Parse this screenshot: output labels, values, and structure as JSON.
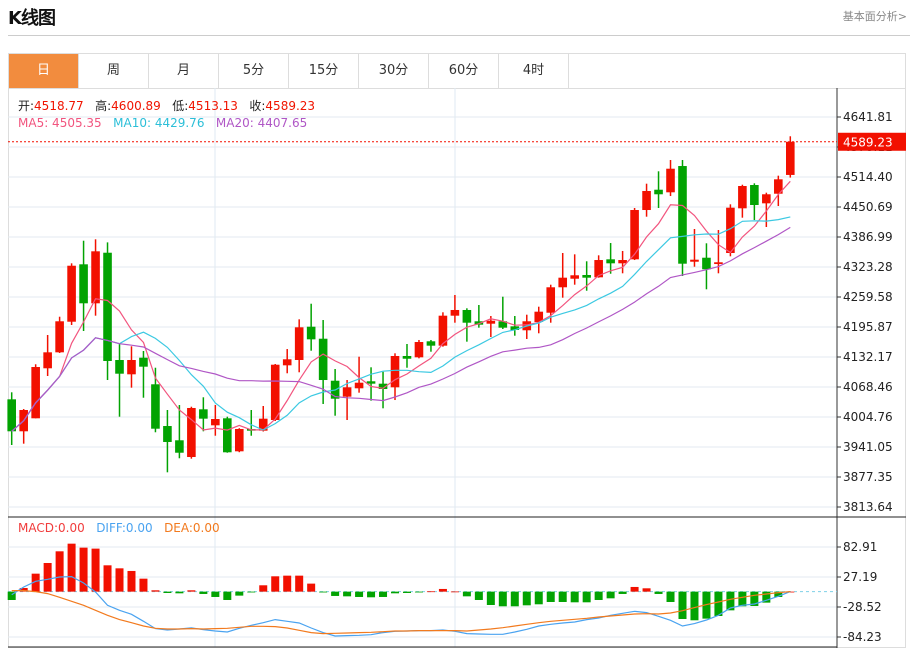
{
  "header": {
    "title": "K线图",
    "link": "基本面分析>"
  },
  "tabs": [
    {
      "label": "日",
      "active": true
    },
    {
      "label": "周"
    },
    {
      "label": "月"
    },
    {
      "label": "5分"
    },
    {
      "label": "15分"
    },
    {
      "label": "30分"
    },
    {
      "label": "60分"
    },
    {
      "label": "4时"
    }
  ],
  "ohlc_legend": {
    "open_label": "开:",
    "open": "4518.77",
    "high_label": "高:",
    "high": "4600.89",
    "low_label": "低:",
    "low": "4513.13",
    "close_label": "收:",
    "close": "4589.23"
  },
  "ma_legend": {
    "ma5": "MA5: 4505.35",
    "ma10": "MA10: 4429.76",
    "ma20": "MA20: 4407.65"
  },
  "macd_legend": {
    "macd": "MACD:0.00",
    "diff": "DIFF:0.00",
    "dea": "DEA:0.00"
  },
  "colors": {
    "up": "#f21000",
    "down": "#02a302",
    "ma5": "#f2557f",
    "ma10": "#3cc9e2",
    "ma20": "#b057c6",
    "diff": "#4aa3f0",
    "dea": "#f27a1e",
    "accent": "#f28c3e"
  },
  "chart_data": [
    {
      "type": "candlestick",
      "current_price": "4589.23",
      "y_ticks": [
        "4641.81",
        "4578.11",
        "4514.40",
        "4450.69",
        "4386.99",
        "4323.28",
        "4259.58",
        "4195.87",
        "4132.17",
        "4068.46",
        "4004.76",
        "3941.05",
        "3877.35",
        "3813.64"
      ],
      "ylim": [
        3813.64,
        4641.81
      ],
      "grid": true,
      "moving_averages": [
        5,
        10,
        20
      ],
      "candles_ohlc": [
        [
          4042.3,
          4057.2,
          3945.3,
          3974.4
        ],
        [
          3974.4,
          4021.7,
          3948.1,
          4019.6
        ],
        [
          4002.0,
          4116.7,
          4002.0,
          4110.9
        ],
        [
          4108.2,
          4178.9,
          4091.8,
          4142.1
        ],
        [
          4142.1,
          4217.7,
          4140.7,
          4208.0
        ],
        [
          4207.1,
          4331.1,
          4200.1,
          4326.0
        ],
        [
          4329.0,
          4379.1,
          4187.4,
          4246.2
        ],
        [
          4246.2,
          4382.1,
          4219.9,
          4356.6
        ],
        [
          4353.6,
          4375.7,
          4083.3,
          4123.7
        ],
        [
          4125.8,
          4161.3,
          4005.4,
          4096.7
        ],
        [
          4095.4,
          4154.9,
          4067.0,
          4125.8
        ],
        [
          4130.7,
          4144.9,
          4045.7,
          4111.6
        ],
        [
          4074.2,
          4109.4,
          3972.3,
          3979.9
        ],
        [
          3985.6,
          4019.6,
          3887.3,
          3951.7
        ],
        [
          3955.3,
          4030.2,
          3917.1,
          3928.9
        ],
        [
          3919.8,
          4026.6,
          3916.2,
          4023.9
        ],
        [
          4021.1,
          4046.6,
          3974.4,
          4001.2
        ],
        [
          3987.1,
          4030.2,
          3965.0,
          4000.5
        ],
        [
          4002.0,
          4005.4,
          3928.9,
          3929.8
        ],
        [
          3931.9,
          3981.0,
          3930.0,
          3979.3
        ],
        [
          3979.3,
          4019.6,
          3965.0,
          3975.7
        ],
        [
          3975.7,
          4028.1,
          3974.0,
          4001.2
        ],
        [
          3998.4,
          4117.3,
          3996.3,
          4115.8
        ],
        [
          4114.5,
          4149.1,
          4097.6,
          4127.3
        ],
        [
          4125.8,
          4212.2,
          4099.7,
          4195.2
        ],
        [
          4196.5,
          4245.3,
          4145.5,
          4169.7
        ],
        [
          4171.0,
          4210.7,
          4032.4,
          4083.3
        ],
        [
          4081.8,
          4106.7,
          4007.5,
          4043.6
        ],
        [
          4047.9,
          4083.3,
          3998.4,
          4067.8
        ],
        [
          4065.7,
          4132.8,
          4056.4,
          4077.6
        ],
        [
          4080.6,
          4110.3,
          4039.4,
          4075.5
        ],
        [
          4075.5,
          4100.9,
          4023.2,
          4064.2
        ],
        [
          4067.8,
          4140.0,
          4040.8,
          4134.3
        ],
        [
          4134.3,
          4159.8,
          4109.4,
          4128.5
        ],
        [
          4131.5,
          4168.3,
          4129.4,
          4164.0
        ],
        [
          4165.5,
          4168.3,
          4143.4,
          4156.2
        ],
        [
          4156.2,
          4227.1,
          4154.1,
          4219.9
        ],
        [
          4219.9,
          4263.8,
          4205.0,
          4232.0
        ],
        [
          4232.0,
          4235.6,
          4164.7,
          4205.0
        ],
        [
          4208.0,
          4242.6,
          4194.4,
          4200.8
        ],
        [
          4202.9,
          4219.2,
          4174.6,
          4209.2
        ],
        [
          4208.0,
          4260.2,
          4191.6,
          4194.4
        ],
        [
          4197.3,
          4219.2,
          4177.4,
          4189.5
        ],
        [
          4188.9,
          4222.0,
          4170.4,
          4208.0
        ],
        [
          4206.5,
          4239.0,
          4182.5,
          4228.4
        ],
        [
          4226.2,
          4285.7,
          4205.0,
          4280.2
        ],
        [
          4280.2,
          4353.0,
          4258.1,
          4300.6
        ],
        [
          4298.4,
          4350.2,
          4285.7,
          4305.7
        ],
        [
          4306.3,
          4335.4,
          4272.9,
          4300.6
        ],
        [
          4301.4,
          4348.1,
          4300.6,
          4338.1
        ],
        [
          4339.6,
          4374.2,
          4309.0,
          4331.1
        ],
        [
          4331.1,
          4357.3,
          4309.9,
          4338.1
        ],
        [
          4339.6,
          4448.6,
          4338.1,
          4444.3
        ],
        [
          4444.3,
          4500.2,
          4430.1,
          4484.7
        ],
        [
          4487.4,
          4526.5,
          4448.6,
          4477.7
        ],
        [
          4481.9,
          4550.5,
          4474.0,
          4532.0
        ],
        [
          4537.7,
          4550.5,
          4304.2,
          4330.3
        ],
        [
          4334.5,
          4404.0,
          4323.9,
          4338.8
        ],
        [
          4343.0,
          4373.6,
          4275.9,
          4318.4
        ],
        [
          4329.6,
          4401.8,
          4309.9,
          4333.3
        ],
        [
          4353.0,
          4456.4,
          4346.0,
          4449.2
        ],
        [
          4447.9,
          4498.0,
          4428.0,
          4495.3
        ],
        [
          4497.4,
          4501.0,
          4423.1,
          4454.9
        ],
        [
          4458.5,
          4481.1,
          4408.2,
          4477.7
        ],
        [
          4478.9,
          4517.2,
          4452.8,
          4509.5
        ],
        [
          4518.77,
          4600.89,
          4513.13,
          4589.23
        ]
      ]
    },
    {
      "type": "bar+line",
      "y_ticks": [
        "82.91",
        "27.19",
        "-28.52",
        "-84.23"
      ],
      "ylim": [
        -84.23,
        82.91
      ],
      "macd": [
        -15.5,
        6.8,
        33.4,
        53.2,
        74.9,
        89.1,
        81.7,
        79.9,
        48.9,
        43.3,
        38.4,
        24.1,
        2.5,
        -2.5,
        -3.1,
        2.5,
        -4.3,
        -9.9,
        -15.5,
        -7.4,
        -0.6,
        11.8,
        28.5,
        29.7,
        29.7,
        14.9,
        -0.6,
        -8.0,
        -8.7,
        -9.9,
        -10.5,
        -9.9,
        -3.1,
        -2.5,
        -1.2,
        0.6,
        5.0,
        0.3,
        -8.7,
        -15.5,
        -24.8,
        -27.2,
        -27.2,
        -25.4,
        -23.5,
        -19.2,
        -19.2,
        -19.8,
        -19.8,
        -15.5,
        -12.4,
        -4.3,
        8.7,
        6.2,
        -4.3,
        -19.2,
        -50.8,
        -53.2,
        -50.1,
        -45.2,
        -34.7,
        -27.2,
        -26.6,
        -20.4,
        -9.9,
        0
      ],
      "diff": [
        -5.6,
        8.7,
        19.2,
        22.9,
        27.2,
        27.9,
        16.1,
        -0.6,
        -25.4,
        -34.7,
        -42.1,
        -55.1,
        -68.7,
        -71.2,
        -69.3,
        -67.4,
        -70.6,
        -73.0,
        -74.9,
        -68.1,
        -62.5,
        -57.6,
        -52.0,
        -55.1,
        -58.2,
        -67.5,
        -76.1,
        -82.3,
        -81.7,
        -81.1,
        -79.9,
        -76.1,
        -73.7,
        -73.0,
        -72.4,
        -72.4,
        -71.2,
        -73.7,
        -78.0,
        -78.7,
        -79.3,
        -79.3,
        -74.9,
        -69.9,
        -63.8,
        -60.7,
        -58.2,
        -56.3,
        -52.0,
        -48.9,
        -43.9,
        -40.2,
        -36.5,
        -39.0,
        -45.8,
        -53.2,
        -63.8,
        -59.4,
        -52.6,
        -43.9,
        -30.3,
        -25.4,
        -22.9,
        -16.1,
        -8.7,
        0
      ],
      "dea": [
        1.9,
        1.9,
        0,
        -3.7,
        -10.5,
        -18.0,
        -25.4,
        -34.7,
        -43.9,
        -52.0,
        -57.6,
        -63.8,
        -68.1,
        -69.3,
        -69.3,
        -68.7,
        -69.3,
        -68.7,
        -68.1,
        -66.2,
        -64.4,
        -64.4,
        -65.0,
        -67.5,
        -71.8,
        -76.1,
        -78.0,
        -77.4,
        -76.8,
        -76.1,
        -75.5,
        -74.3,
        -73.0,
        -73.0,
        -72.4,
        -72.4,
        -72.4,
        -72.4,
        -73.0,
        -71.2,
        -69.3,
        -66.9,
        -63.8,
        -60.7,
        -57.6,
        -55.1,
        -53.2,
        -51.4,
        -49.5,
        -47.0,
        -45.2,
        -43.3,
        -41.5,
        -40.9,
        -41.5,
        -39.6,
        -35.3,
        -29.7,
        -24.1,
        -19.2,
        -14.2,
        -10.5,
        -6.8,
        -4.3,
        -1.9,
        0
      ]
    }
  ]
}
